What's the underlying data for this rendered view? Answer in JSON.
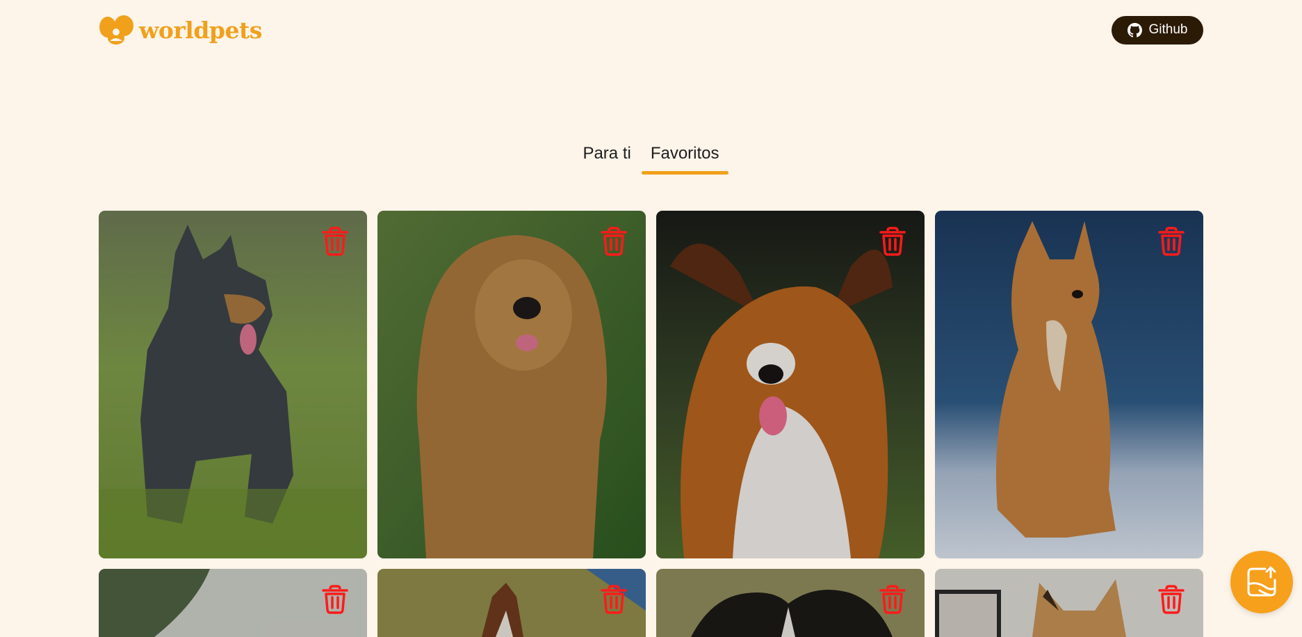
{
  "header": {
    "logo_text": "worldpets",
    "github_label": "Github"
  },
  "tabs": [
    {
      "label": "Para ti",
      "active": false
    },
    {
      "label": "Favoritos",
      "active": true
    }
  ],
  "colors": {
    "background": "#fdf4ea",
    "accent": "#f0a01a",
    "github_bg": "#2b1a06",
    "trash": "#ff1a1a"
  },
  "cards": [
    {
      "icon": "trash-icon",
      "depicts": "blue heeler dog in grass"
    },
    {
      "icon": "trash-icon",
      "depicts": "golden retriever"
    },
    {
      "icon": "trash-icon",
      "depicts": "papillon dog"
    },
    {
      "icon": "trash-icon",
      "depicts": "shiba-like dog in snow"
    },
    {
      "icon": "trash-icon",
      "depicts": "dog outdoors"
    },
    {
      "icon": "trash-icon",
      "depicts": "husky on grass"
    },
    {
      "icon": "trash-icon",
      "depicts": "border collie"
    },
    {
      "icon": "trash-icon",
      "depicts": "small dog indoors"
    }
  ],
  "fab": {
    "icon": "upload-photo-icon"
  }
}
